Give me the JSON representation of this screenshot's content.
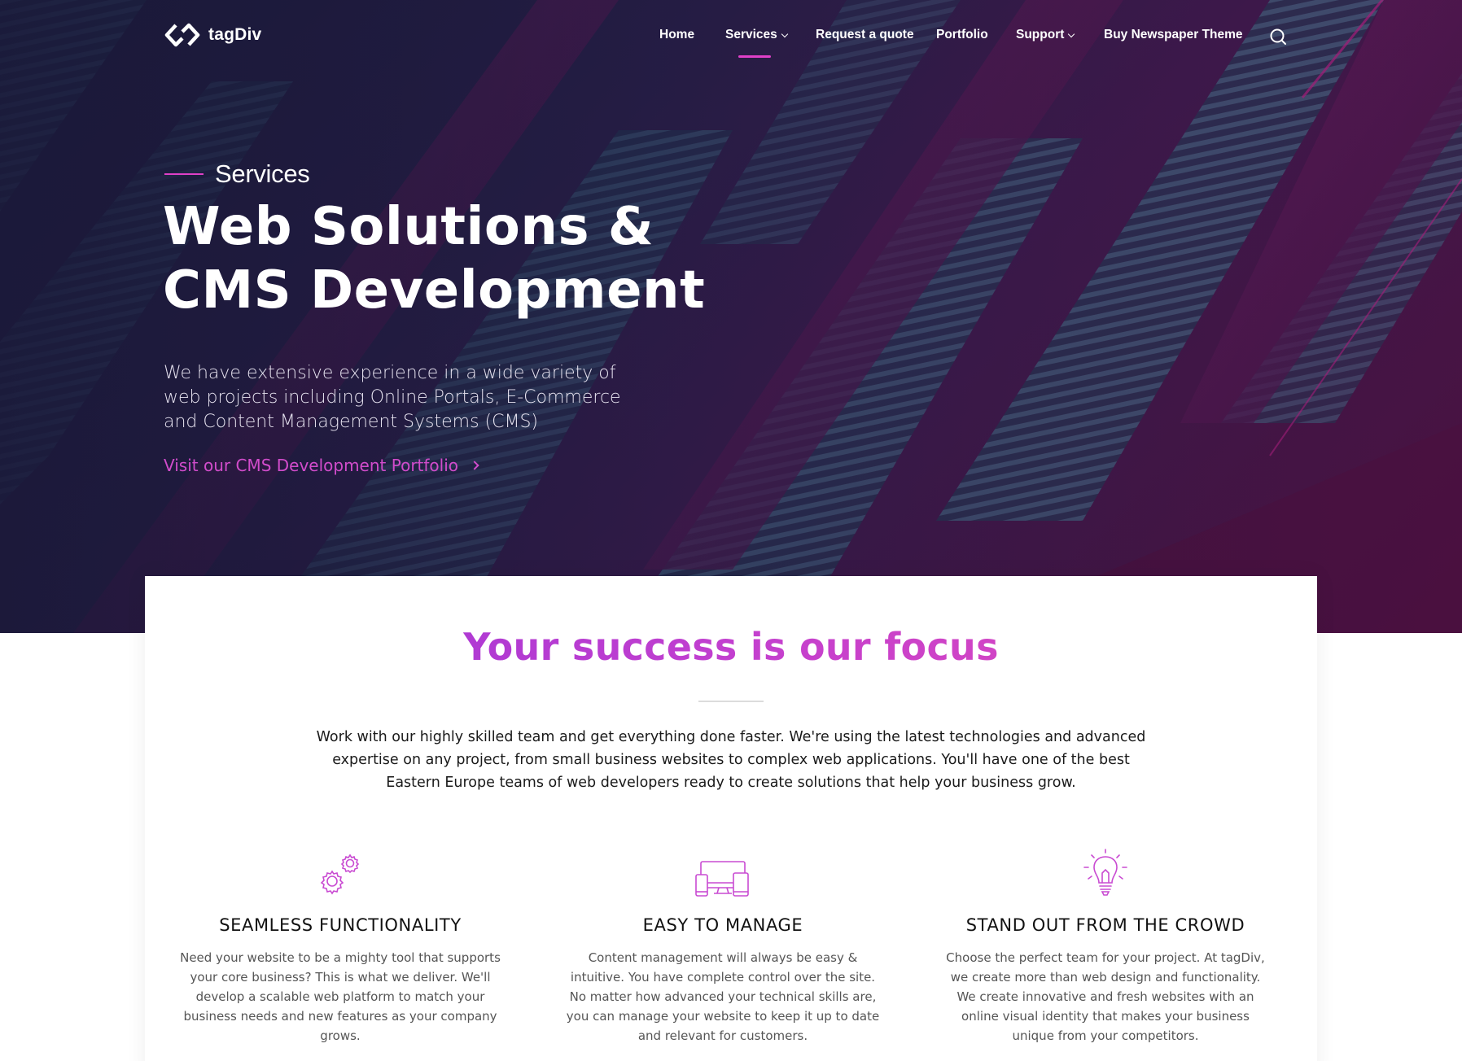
{
  "brand": {
    "name": "tagDiv",
    "accent": "#e040c8"
  },
  "nav": {
    "items": [
      {
        "label": "Home",
        "has_dropdown": false,
        "active": false
      },
      {
        "label": "Services",
        "has_dropdown": true,
        "active": true
      },
      {
        "label": "Request a quote",
        "has_dropdown": false,
        "active": false
      },
      {
        "label": "Portfolio",
        "has_dropdown": false,
        "active": false
      },
      {
        "label": "Support",
        "has_dropdown": true,
        "active": false
      },
      {
        "label": "Buy Newspaper Theme",
        "has_dropdown": false,
        "active": false
      }
    ],
    "search_icon": "search-icon"
  },
  "hero": {
    "kicker": "Services",
    "title_line1": "Web Solutions &",
    "title_line2": "CMS Development",
    "description": "We have extensive experience in a wide variety of web projects including Online Portals, E-Commerce and Content Management Systems (CMS)",
    "link_label": "Visit our CMS Development Portfolio"
  },
  "focus": {
    "title": "Your success is our focus",
    "description": "Work with our highly skilled team and get everything done faster. We're using the latest technologies and advanced expertise on any project, from small business websites to complex web applications. You'll have one of the best Eastern Europe teams of web developers ready to create solutions that help your business grow."
  },
  "features": [
    {
      "icon": "gears-icon",
      "title": "SEAMLESS FUNCTIONALITY",
      "description": "Need your website to be a mighty tool that supports your core business? This is what we deliver. We'll develop a scalable web platform to match your business needs and new features as your company grows."
    },
    {
      "icon": "devices-icon",
      "title": "EASY TO MANAGE",
      "description": "Content management will always be easy & intuitive. You have complete control over the site. No matter how advanced your technical skills are, you can manage your website to keep it up to date and relevant for customers."
    },
    {
      "icon": "lightbulb-icon",
      "title": "STAND OUT FROM THE CROWD",
      "description": "Choose the perfect team for your project. At tagDiv, we create more than web design and functionality. We create innovative and fresh websites with an online visual identity that makes your business unique from your competitors."
    }
  ]
}
